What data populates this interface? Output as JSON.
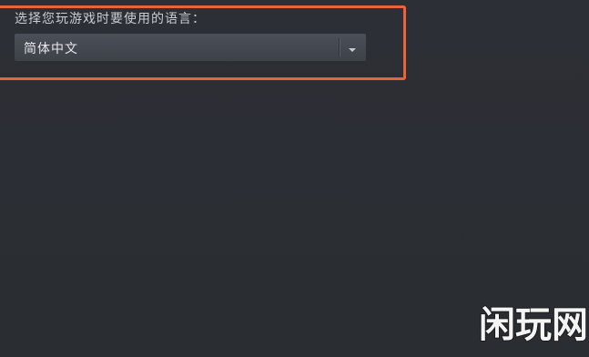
{
  "settings": {
    "language_label": "选择您玩游戏时要使用的语言：",
    "language_select": {
      "selected_value": "简体中文",
      "dropdown_icon": "chevron-down-icon"
    }
  },
  "watermark": {
    "text": "闲玩网"
  },
  "colors": {
    "background": "#2a2d32",
    "highlight": "#e8643c",
    "select_bg": "#45494f",
    "label_text": "#c9ccd1",
    "value_text": "#e6e8eb"
  }
}
